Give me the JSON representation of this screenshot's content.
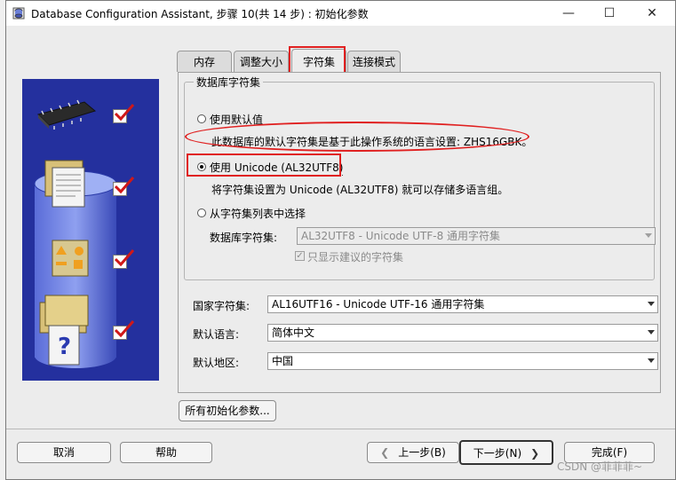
{
  "window": {
    "title": "Database Configuration Assistant, 步骤 10(共 14 步) : 初始化参数",
    "minimize": "—",
    "maximize": "☐",
    "close": "✕"
  },
  "tabs": [
    {
      "label": "内存"
    },
    {
      "label": "调整大小"
    },
    {
      "label": "字符集"
    },
    {
      "label": "连接模式"
    }
  ],
  "charset_group": {
    "legend": "数据库字符集",
    "option_default": "使用默认值",
    "default_desc": "此数据库的默认字符集是基于此操作系统的语言设置: ZHS16GBK。",
    "option_unicode": "使用 Unicode (AL32UTF8)",
    "unicode_desc": "将字符集设置为 Unicode (AL32UTF8) 就可以存储多语言组。",
    "option_list": "从字符集列表中选择",
    "db_charset_label": "数据库字符集:",
    "db_charset_value": "AL32UTF8 - Unicode UTF-8 通用字符集",
    "show_recommended": "只显示建议的字符集",
    "selected": "unicode"
  },
  "national": {
    "label": "国家字符集:",
    "value": "AL16UTF16 - Unicode UTF-16 通用字符集"
  },
  "language": {
    "label": "默认语言:",
    "value": "简体中文"
  },
  "territory": {
    "label": "默认地区:",
    "value": "中国"
  },
  "buttons": {
    "all_params": "所有初始化参数...",
    "cancel": "取消",
    "help": "帮助",
    "back": "上一步(B)",
    "next": "下一步(N)",
    "finish": "完成(F)"
  },
  "watermark": "CSDN @菲菲菲~",
  "colors": {
    "annotation_red": "#e02020",
    "art_blue": "#24309e",
    "check_red": "#d01818"
  }
}
